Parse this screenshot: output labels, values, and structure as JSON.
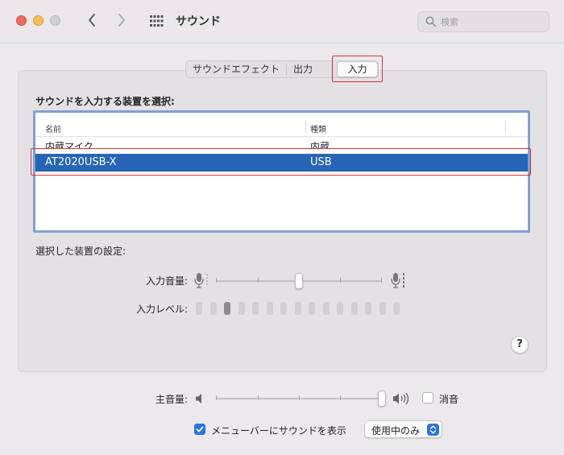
{
  "window": {
    "title": "サウンド"
  },
  "search": {
    "placeholder": "検索"
  },
  "tabs": [
    {
      "label": "サウンドエフェクト",
      "active": false
    },
    {
      "label": "出力",
      "active": false
    },
    {
      "label": "入力",
      "active": true
    }
  ],
  "input": {
    "heading": "サウンドを入力する装置を選択:",
    "columns": {
      "name": "名前",
      "type": "種類"
    },
    "devices": [
      {
        "name": "内蔵マイク",
        "type": "内蔵",
        "selected": false
      },
      {
        "name": "AT2020USB-X",
        "type": "USB",
        "selected": true
      }
    ],
    "settings_heading": "選択した装置の設定:",
    "input_volume_label": "入力音量:",
    "input_volume_fraction": 0.5,
    "input_level_label": "入力レベル:",
    "input_level": {
      "segments": 15,
      "active_index": 2
    }
  },
  "help": {
    "label": "?"
  },
  "output": {
    "main_volume_label": "主音量:",
    "main_volume_fraction": 1.0,
    "mute_label": "消音",
    "mute_checked": false
  },
  "menubar": {
    "show_label": "メニューバーにサウンドを表示",
    "checked": true,
    "mode_value": "使用中のみ"
  },
  "colors": {
    "selection": "#2664b6",
    "accent": "#2a72e3",
    "highlight_box": "#d8303c"
  }
}
